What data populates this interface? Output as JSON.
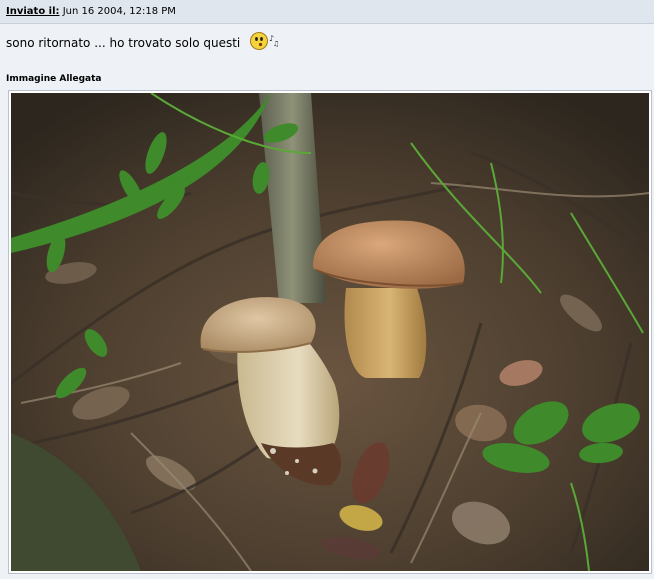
{
  "post": {
    "posted_label": "Inviato il:",
    "posted_date": "Jun 16 2004, 12:18 PM",
    "message": "sono ritornato ... ho trovato solo questi"
  },
  "attachment": {
    "heading": "Immagine Allegata",
    "photo_icon": "mushrooms-photo"
  },
  "smiley": {
    "icon": "whistling-smiley-icon"
  },
  "colors": {
    "header_bg": "#dfe6ee",
    "body_bg": "#eef2f7",
    "frame_border": "#b9c2cc"
  }
}
